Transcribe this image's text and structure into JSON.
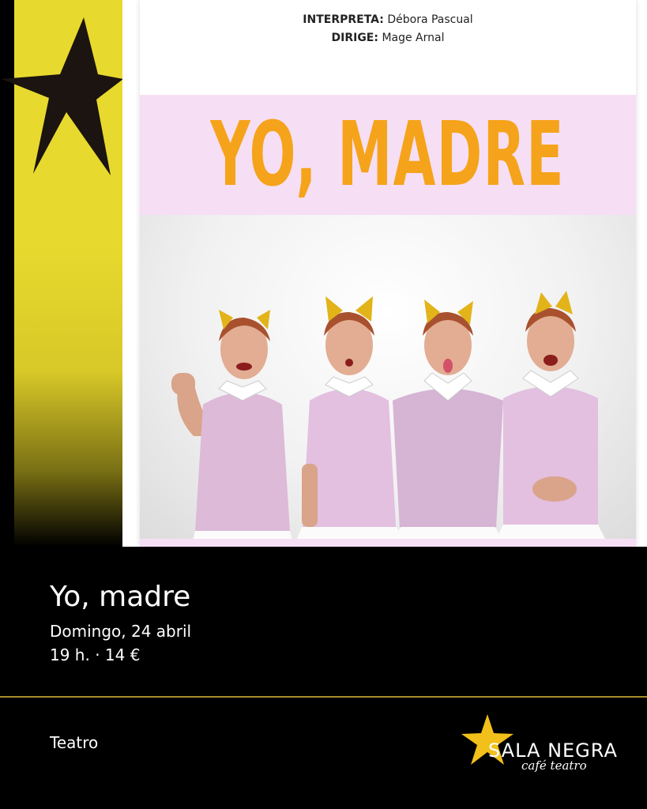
{
  "poster": {
    "credit1_label": "INTERPRETA:",
    "credit1_value": "Débora Pascual",
    "credit2_label": "DIRIGE:",
    "credit2_value": "Mage Arnal",
    "title": "YO, MADRE",
    "photo_description": "four-women-in-pink-uniforms"
  },
  "event": {
    "title": "Yo, madre",
    "date": "Domingo, 24 abril",
    "time_price": "19 h. ·  14 €",
    "category": "Teatro"
  },
  "logo": {
    "name": "SALA NEGRA",
    "tagline": "café teatro"
  },
  "colors": {
    "accent_yellow": "#e8d92e",
    "title_orange": "#f5a31a",
    "band_pink": "#f6dff4",
    "logo_star": "#f2c01a",
    "divider_gold": "#a98a2a"
  }
}
